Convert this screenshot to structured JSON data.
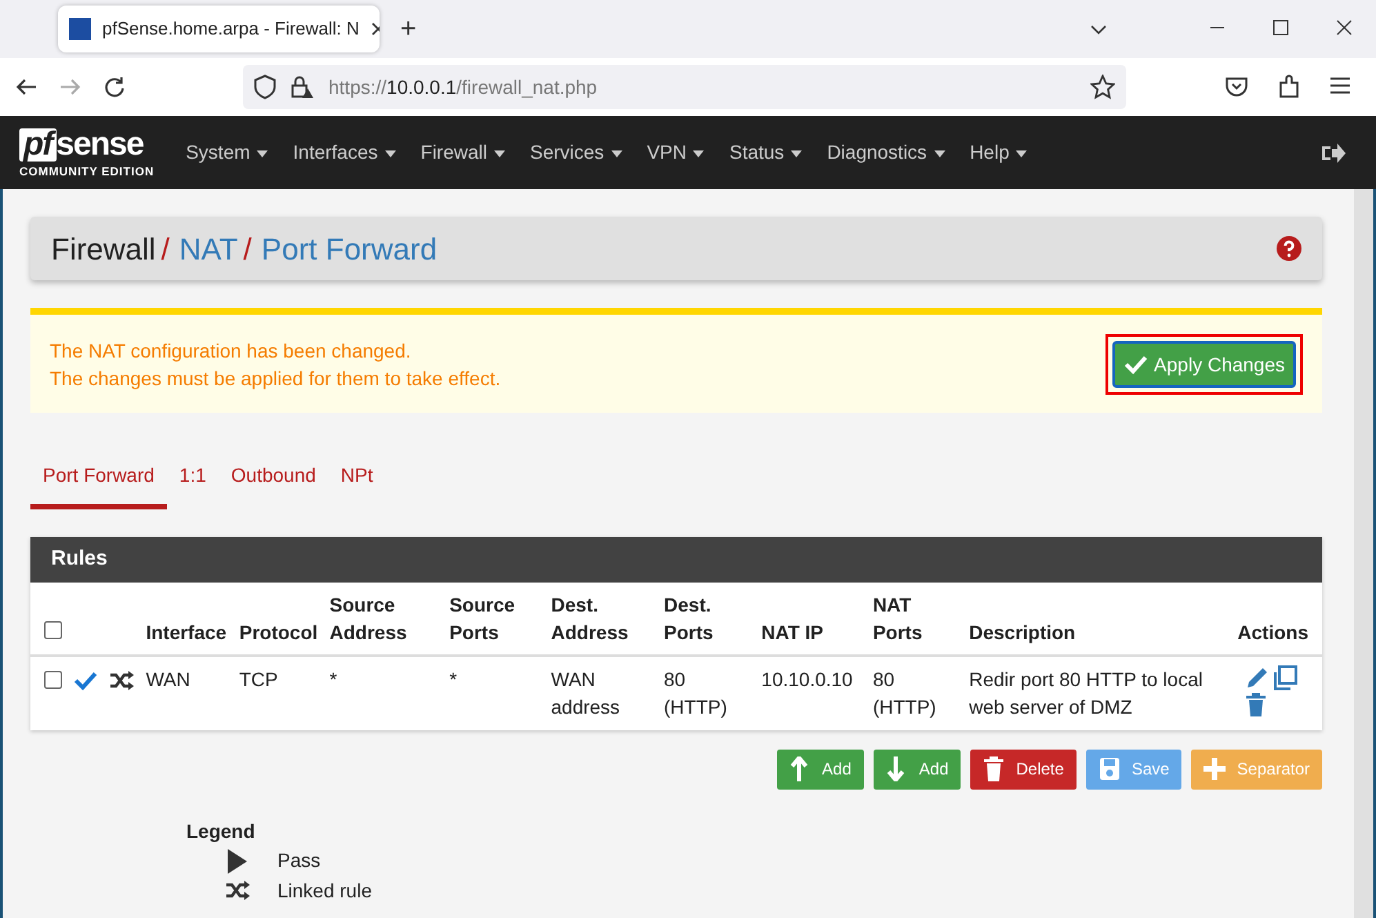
{
  "browser": {
    "tab_title": "pfSense.home.arpa - Firewall: N",
    "new_tab": "+",
    "url_scheme": "https://",
    "url_host": "10.0.0.1",
    "url_path": "/firewall_nat.php"
  },
  "navbar": {
    "brand_prefix": "pf",
    "brand_name": "sense",
    "brand_edition": "COMMUNITY EDITION",
    "menu": [
      "System",
      "Interfaces",
      "Firewall",
      "Services",
      "VPN",
      "Status",
      "Diagnostics",
      "Help"
    ]
  },
  "breadcrumb": [
    {
      "label": "Firewall",
      "link": false,
      "separator": "/"
    },
    {
      "label": "NAT",
      "link": true,
      "separator": "/"
    },
    {
      "label": "Port Forward",
      "link": true
    }
  ],
  "alert": {
    "lines": [
      "The NAT configuration has been changed.",
      "The changes must be applied for them to take effect."
    ],
    "button": "Apply Changes",
    "highlighted": true
  },
  "tabs": [
    {
      "label": "Port Forward",
      "selected": true
    },
    {
      "label": "1:1",
      "selected": false
    },
    {
      "label": "Outbound",
      "selected": false
    },
    {
      "label": "NPt",
      "selected": false
    }
  ],
  "rules": {
    "title": "Rules",
    "select_all_checked": false,
    "columns": [
      "Interface",
      "Protocol",
      "Source Address",
      "Source Ports",
      "Dest. Address",
      "Dest. Ports",
      "NAT IP",
      "NAT Ports",
      "Description",
      "Actions"
    ],
    "rows": [
      {
        "checked": false,
        "enabled": true,
        "linked": true,
        "cells": [
          "WAN",
          "TCP",
          "*",
          "*",
          "WAN address",
          "80 (HTTP)",
          "10.10.0.10",
          "80 (HTTP)",
          "Redir port 80 HTTP to local web server of DMZ"
        ]
      }
    ]
  },
  "buttons": [
    {
      "kind": "add_above",
      "label": "Add"
    },
    {
      "kind": "add_below",
      "label": "Add"
    },
    {
      "kind": "delete",
      "label": "Delete"
    },
    {
      "kind": "save",
      "label": "Save"
    },
    {
      "kind": "separator",
      "label": "Separator"
    }
  ],
  "legend": {
    "title": "Legend",
    "items": [
      {
        "kind": "pass",
        "label": "Pass"
      },
      {
        "kind": "linked",
        "label": "Linked rule"
      }
    ]
  }
}
